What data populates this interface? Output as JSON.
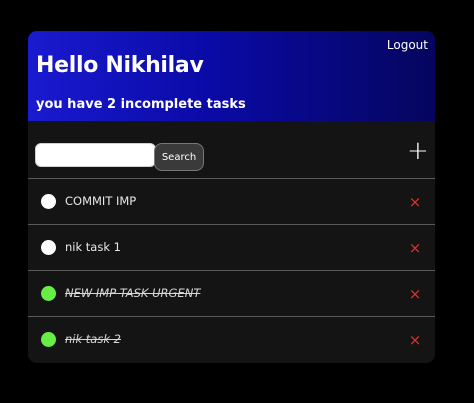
{
  "header": {
    "logout_label": "Logout",
    "greeting": "Hello Nikhilav",
    "subtitle": "you have 2 incomplete tasks"
  },
  "search": {
    "value": "",
    "placeholder": "",
    "button_label": "Search"
  },
  "add": {
    "icon": "+"
  },
  "colors": {
    "pending_dot": "#ffffff",
    "done_dot": "#66ee44",
    "delete": "#e0322c",
    "header_start": "#1a1ad0",
    "header_end": "#05055e"
  },
  "tasks": [
    {
      "label": "COMMIT IMP",
      "completed": false,
      "delete_icon": "×"
    },
    {
      "label": "nik task 1",
      "completed": false,
      "delete_icon": "×"
    },
    {
      "label": "NEW IMP TASK URGENT",
      "completed": true,
      "delete_icon": "×"
    },
    {
      "label": "nik task 2",
      "completed": true,
      "delete_icon": "×"
    }
  ]
}
